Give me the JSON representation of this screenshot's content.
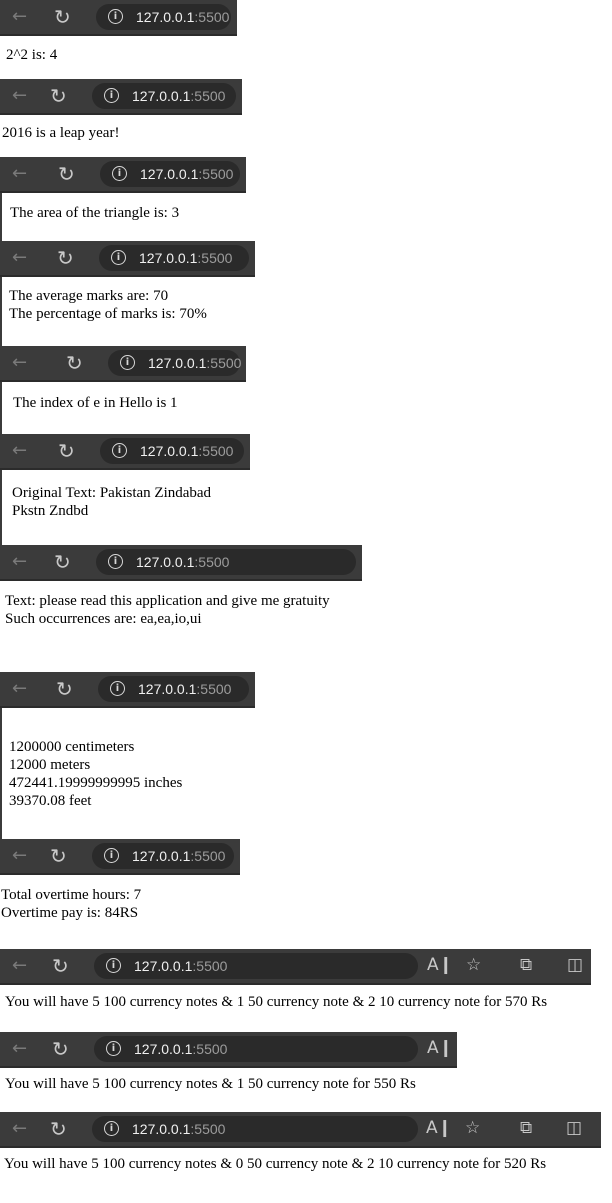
{
  "url": {
    "host": "127.0.0.1",
    "port": ":5500"
  },
  "icons": {
    "back": "arrow-left-icon",
    "reload": "reload-icon",
    "info": "info-icon",
    "read_aloud": "read-aloud-icon",
    "favorite": "star-icon",
    "extensions": "puzzle-icon",
    "split": "split-screen-icon"
  },
  "glyphs": {
    "back": "←",
    "reload": "↻",
    "info": "i",
    "read_aloud": "A❙",
    "favorite": "☆",
    "extensions": "⧉",
    "split": "◫"
  },
  "snippets": [
    {
      "lines": [
        "2^2 is: 4"
      ]
    },
    {
      "lines": [
        "2016 is a leap year!"
      ]
    },
    {
      "lines": [
        "The area of the triangle is: 3"
      ]
    },
    {
      "lines": [
        "The average marks are: 70",
        "The percentage of marks is: 70%"
      ]
    },
    {
      "lines": [
        "The index of e in Hello is 1"
      ]
    },
    {
      "lines": [
        "Original Text: Pakistan Zindabad",
        "Pkstn Zndbd"
      ]
    },
    {
      "lines": [
        "Text: please read this application and give me gratuity",
        "Such occurrences are: ea,ea,io,ui"
      ]
    },
    {
      "lines": [
        "1200000 centimeters",
        "12000 meters",
        "472441.19999999995 inches",
        "39370.08 feet"
      ]
    },
    {
      "lines": [
        "Total overtime hours: 7",
        "Overtime pay is: 84RS"
      ]
    },
    {
      "lines": [
        "You will have 5 100 currency notes & 1 50 currency note & 2 10 currency note for 570 Rs"
      ]
    },
    {
      "lines": [
        "You will have 5 100 currency notes & 1 50 currency note for 550 Rs"
      ]
    },
    {
      "lines": [
        "You will have 5 100 currency notes & 0 50 currency note & 2 10 currency note for 520 Rs"
      ]
    }
  ]
}
